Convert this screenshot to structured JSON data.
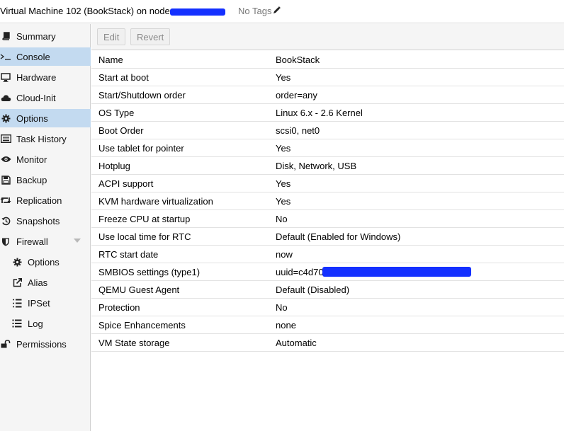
{
  "header": {
    "title": "Virtual Machine 102 (BookStack) on node",
    "tags_label": "No Tags"
  },
  "sidebar": {
    "items": [
      {
        "label": "Summary",
        "icon": "book-icon"
      },
      {
        "label": "Console",
        "icon": "terminal-icon"
      },
      {
        "label": "Hardware",
        "icon": "monitor-icon"
      },
      {
        "label": "Cloud-Init",
        "icon": "cloud-icon"
      },
      {
        "label": "Options",
        "icon": "gear-icon"
      },
      {
        "label": "Task History",
        "icon": "list-icon"
      },
      {
        "label": "Monitor",
        "icon": "eye-icon"
      },
      {
        "label": "Backup",
        "icon": "floppy-icon"
      },
      {
        "label": "Replication",
        "icon": "retweet-icon"
      },
      {
        "label": "Snapshots",
        "icon": "history-icon"
      },
      {
        "label": "Firewall",
        "icon": "shield-icon"
      },
      {
        "label": "Options",
        "icon": "gear-icon"
      },
      {
        "label": "Alias",
        "icon": "external-link-icon"
      },
      {
        "label": "IPSet",
        "icon": "list-ol-icon"
      },
      {
        "label": "Log",
        "icon": "list-icon"
      },
      {
        "label": "Permissions",
        "icon": "unlock-icon"
      }
    ]
  },
  "toolbar": {
    "edit_label": "Edit",
    "revert_label": "Revert"
  },
  "options": {
    "rows": [
      {
        "key": "Name",
        "value": "BookStack"
      },
      {
        "key": "Start at boot",
        "value": "Yes"
      },
      {
        "key": "Start/Shutdown order",
        "value": "order=any"
      },
      {
        "key": "OS Type",
        "value": "Linux 6.x - 2.6 Kernel"
      },
      {
        "key": "Boot Order",
        "value": "scsi0, net0"
      },
      {
        "key": "Use tablet for pointer",
        "value": "Yes"
      },
      {
        "key": "Hotplug",
        "value": "Disk, Network, USB"
      },
      {
        "key": "ACPI support",
        "value": "Yes"
      },
      {
        "key": "KVM hardware virtualization",
        "value": "Yes"
      },
      {
        "key": "Freeze CPU at startup",
        "value": "No"
      },
      {
        "key": "Use local time for RTC",
        "value": "Default (Enabled for Windows)"
      },
      {
        "key": "RTC start date",
        "value": "now"
      },
      {
        "key": "SMBIOS settings (type1)",
        "value": "uuid=c4d70"
      },
      {
        "key": "QEMU Guest Agent",
        "value": "Default (Disabled)"
      },
      {
        "key": "Protection",
        "value": "No"
      },
      {
        "key": "Spice Enhancements",
        "value": "none"
      },
      {
        "key": "VM State storage",
        "value": "Automatic"
      }
    ]
  },
  "colors": {
    "active_nav": "#c3daf0",
    "sidebar_bg": "#f5f5f5",
    "redaction": "#1430ff"
  }
}
